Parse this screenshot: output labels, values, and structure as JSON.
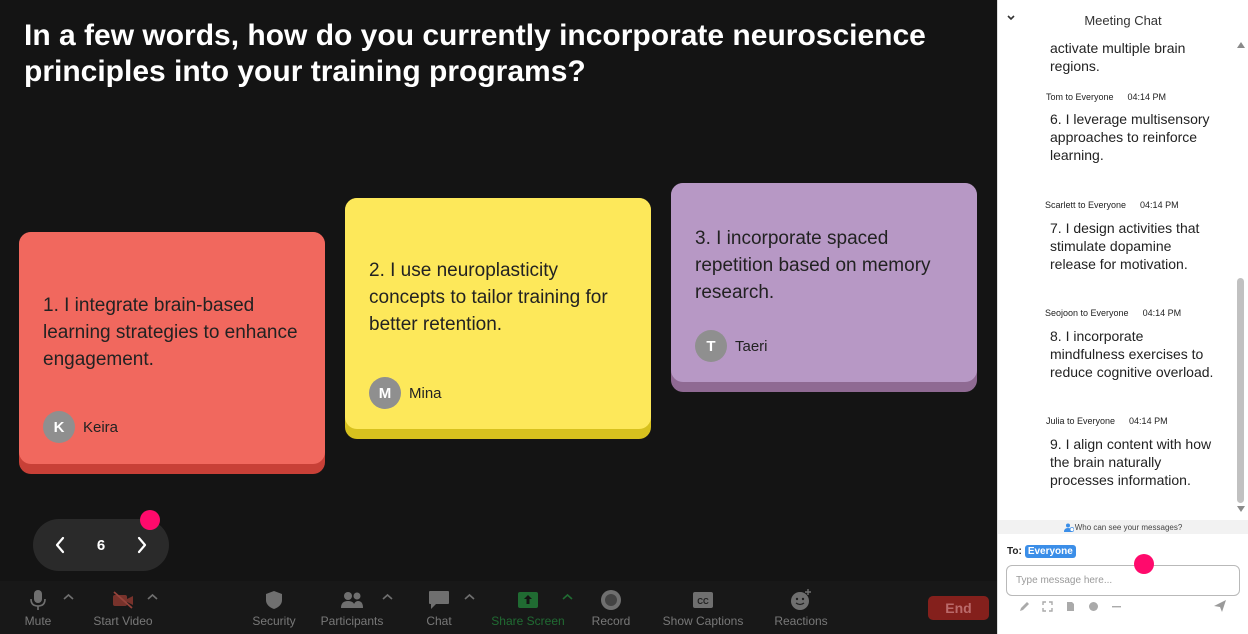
{
  "question": "In a few words, how do you currently incorporate neuroscience principles into your training programs?",
  "cards": [
    {
      "text": "1. I integrate brain-based learning strategies to enhance engagement.",
      "initial": "K",
      "author": "Keira",
      "color": "#f1685e"
    },
    {
      "text": "2. I use neuroplasticity concepts to tailor training for better retention.",
      "initial": "M",
      "author": "Mina",
      "color": "#fde85a"
    },
    {
      "text": "3. I incorporate spaced repetition based on memory research.",
      "initial": "T",
      "author": "Taeri",
      "color": "#b798c5"
    }
  ],
  "pager": {
    "page": "6"
  },
  "toolbar": {
    "mute": "Mute",
    "start_video": "Start Video",
    "security": "Security",
    "participants": "Participants",
    "chat": "Chat",
    "share_screen": "Share Screen",
    "record": "Record",
    "show_captions": "Show Captions",
    "reactions": "Reactions",
    "end": "End"
  },
  "chat": {
    "title": "Meeting Chat",
    "partial_message": "activate multiple brain regions.",
    "messages": [
      {
        "from": "Tom to Everyone",
        "time": "04:14 PM",
        "text": "6. I leverage multisensory approaches to reinforce learning."
      },
      {
        "from": "Scarlett to Everyone",
        "time": "04:14 PM",
        "text": "7. I design activities that stimulate dopamine release for motivation."
      },
      {
        "from": "Seojoon to Everyone",
        "time": "04:14 PM",
        "text": "8. I incorporate mindfulness exercises to reduce cognitive overload."
      },
      {
        "from": "Julia to Everyone",
        "time": "04:14 PM",
        "text": "9. I align content with how the brain naturally processes information."
      }
    ],
    "who_can_see": "Who can see your messages?",
    "to_label": "To:",
    "to_value": "Everyone",
    "input_placeholder": "Type message here..."
  },
  "colors": {
    "accent": "#3b8ee8",
    "pink_dot": "#ff0a6c",
    "end": "#b3241f",
    "share": "#2bb24c"
  }
}
